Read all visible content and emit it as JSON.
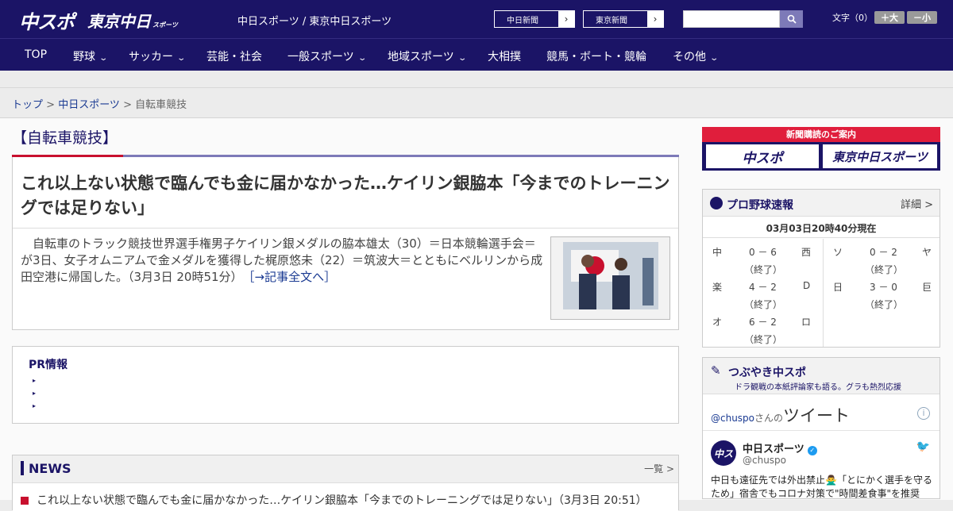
{
  "header": {
    "logo1": "中スポ",
    "logo2": "東京中日",
    "logo2_small": "スポーツ",
    "sites": "中日スポーツ / 東京中日スポーツ",
    "btn1": "中日新聞",
    "btn2": "東京新聞",
    "search_placeholder": "",
    "font_label": "文字（0）",
    "font_up": "＋大",
    "font_down": "－小"
  },
  "nav": [
    {
      "label": "TOP",
      "has_menu": false
    },
    {
      "label": "野球",
      "has_menu": true
    },
    {
      "label": "サッカー",
      "has_menu": true
    },
    {
      "label": "芸能・社会",
      "has_menu": false
    },
    {
      "label": "一般スポーツ",
      "has_menu": true
    },
    {
      "label": "地域スポーツ",
      "has_menu": true
    },
    {
      "label": "大相撲",
      "has_menu": false
    },
    {
      "label": "競馬・ボート・競輪",
      "has_menu": false
    },
    {
      "label": "その他",
      "has_menu": true
    }
  ],
  "breadcrumb": {
    "top": "トップ",
    "sep": " > ",
    "section": "中日スポーツ",
    "current": "自転車競技"
  },
  "category": "【自転車競技】",
  "article": {
    "title": "これ以上ない状態で臨んでも金に届かなかった…ケイリン銀脇本「今までのトレーニングでは足りない」",
    "body": "自転車のトラック競技世界選手権男子ケイリン銀メダルの脇本雄太（30）＝日本競輪選手会＝が3日、女子オムニアムで金メダルを獲得した梶原悠未（22）＝筑波大＝とともにベルリンから成田空港に帰国した。（3月3日 20時51分）",
    "more": "［→記事全文へ］"
  },
  "pr": {
    "title": "PR情報",
    "items": [
      "",
      "",
      ""
    ]
  },
  "news": {
    "title": "NEWS",
    "more": "一覧 >",
    "first": "これ以上ない状態で臨んでも金に届かなかった…ケイリン銀脇本「今までのトレーニングでは足りない」（3月3日 20:51）"
  },
  "sidebar": {
    "subscribe": "新聞購読のご案内",
    "paper1": "中スポ",
    "paper2": "東京中日スポーツ",
    "baseball_title": "プロ野球速報",
    "baseball_detail": "詳細 >",
    "baseball_time": "03月03日20時40分現在",
    "games": [
      {
        "home": "中",
        "score": "0 － 6",
        "status": "（終了）",
        "away": "西"
      },
      {
        "home": "楽",
        "score": "4 － 2",
        "status": "（終了）",
        "away": "D"
      },
      {
        "home": "オ",
        "score": "6 － 2",
        "status": "（終了）",
        "away": "ロ"
      },
      {
        "home": "ソ",
        "score": "0 － 2",
        "status": "（終了）",
        "away": "ヤ"
      },
      {
        "home": "日",
        "score": "3 － 0",
        "status": "（終了）",
        "away": "巨"
      }
    ],
    "tweet_title": "つぶやき中スポ",
    "tweet_sub": "ドラ観戦の本紙評論家も語る。グラも熱烈応援",
    "tweet_handle_link": "@chuspo",
    "tweet_handle_suffix": "さんの",
    "tweet_heading": "ツイート",
    "tweet_name": "中日スポーツ",
    "tweet_user": "@chuspo",
    "tweet_text": "中日も遠征先では外出禁止🙅‍♂️「とにかく選手を守るため」宿舎でもコロナ対策で\"時間差食事\"を推奨"
  }
}
